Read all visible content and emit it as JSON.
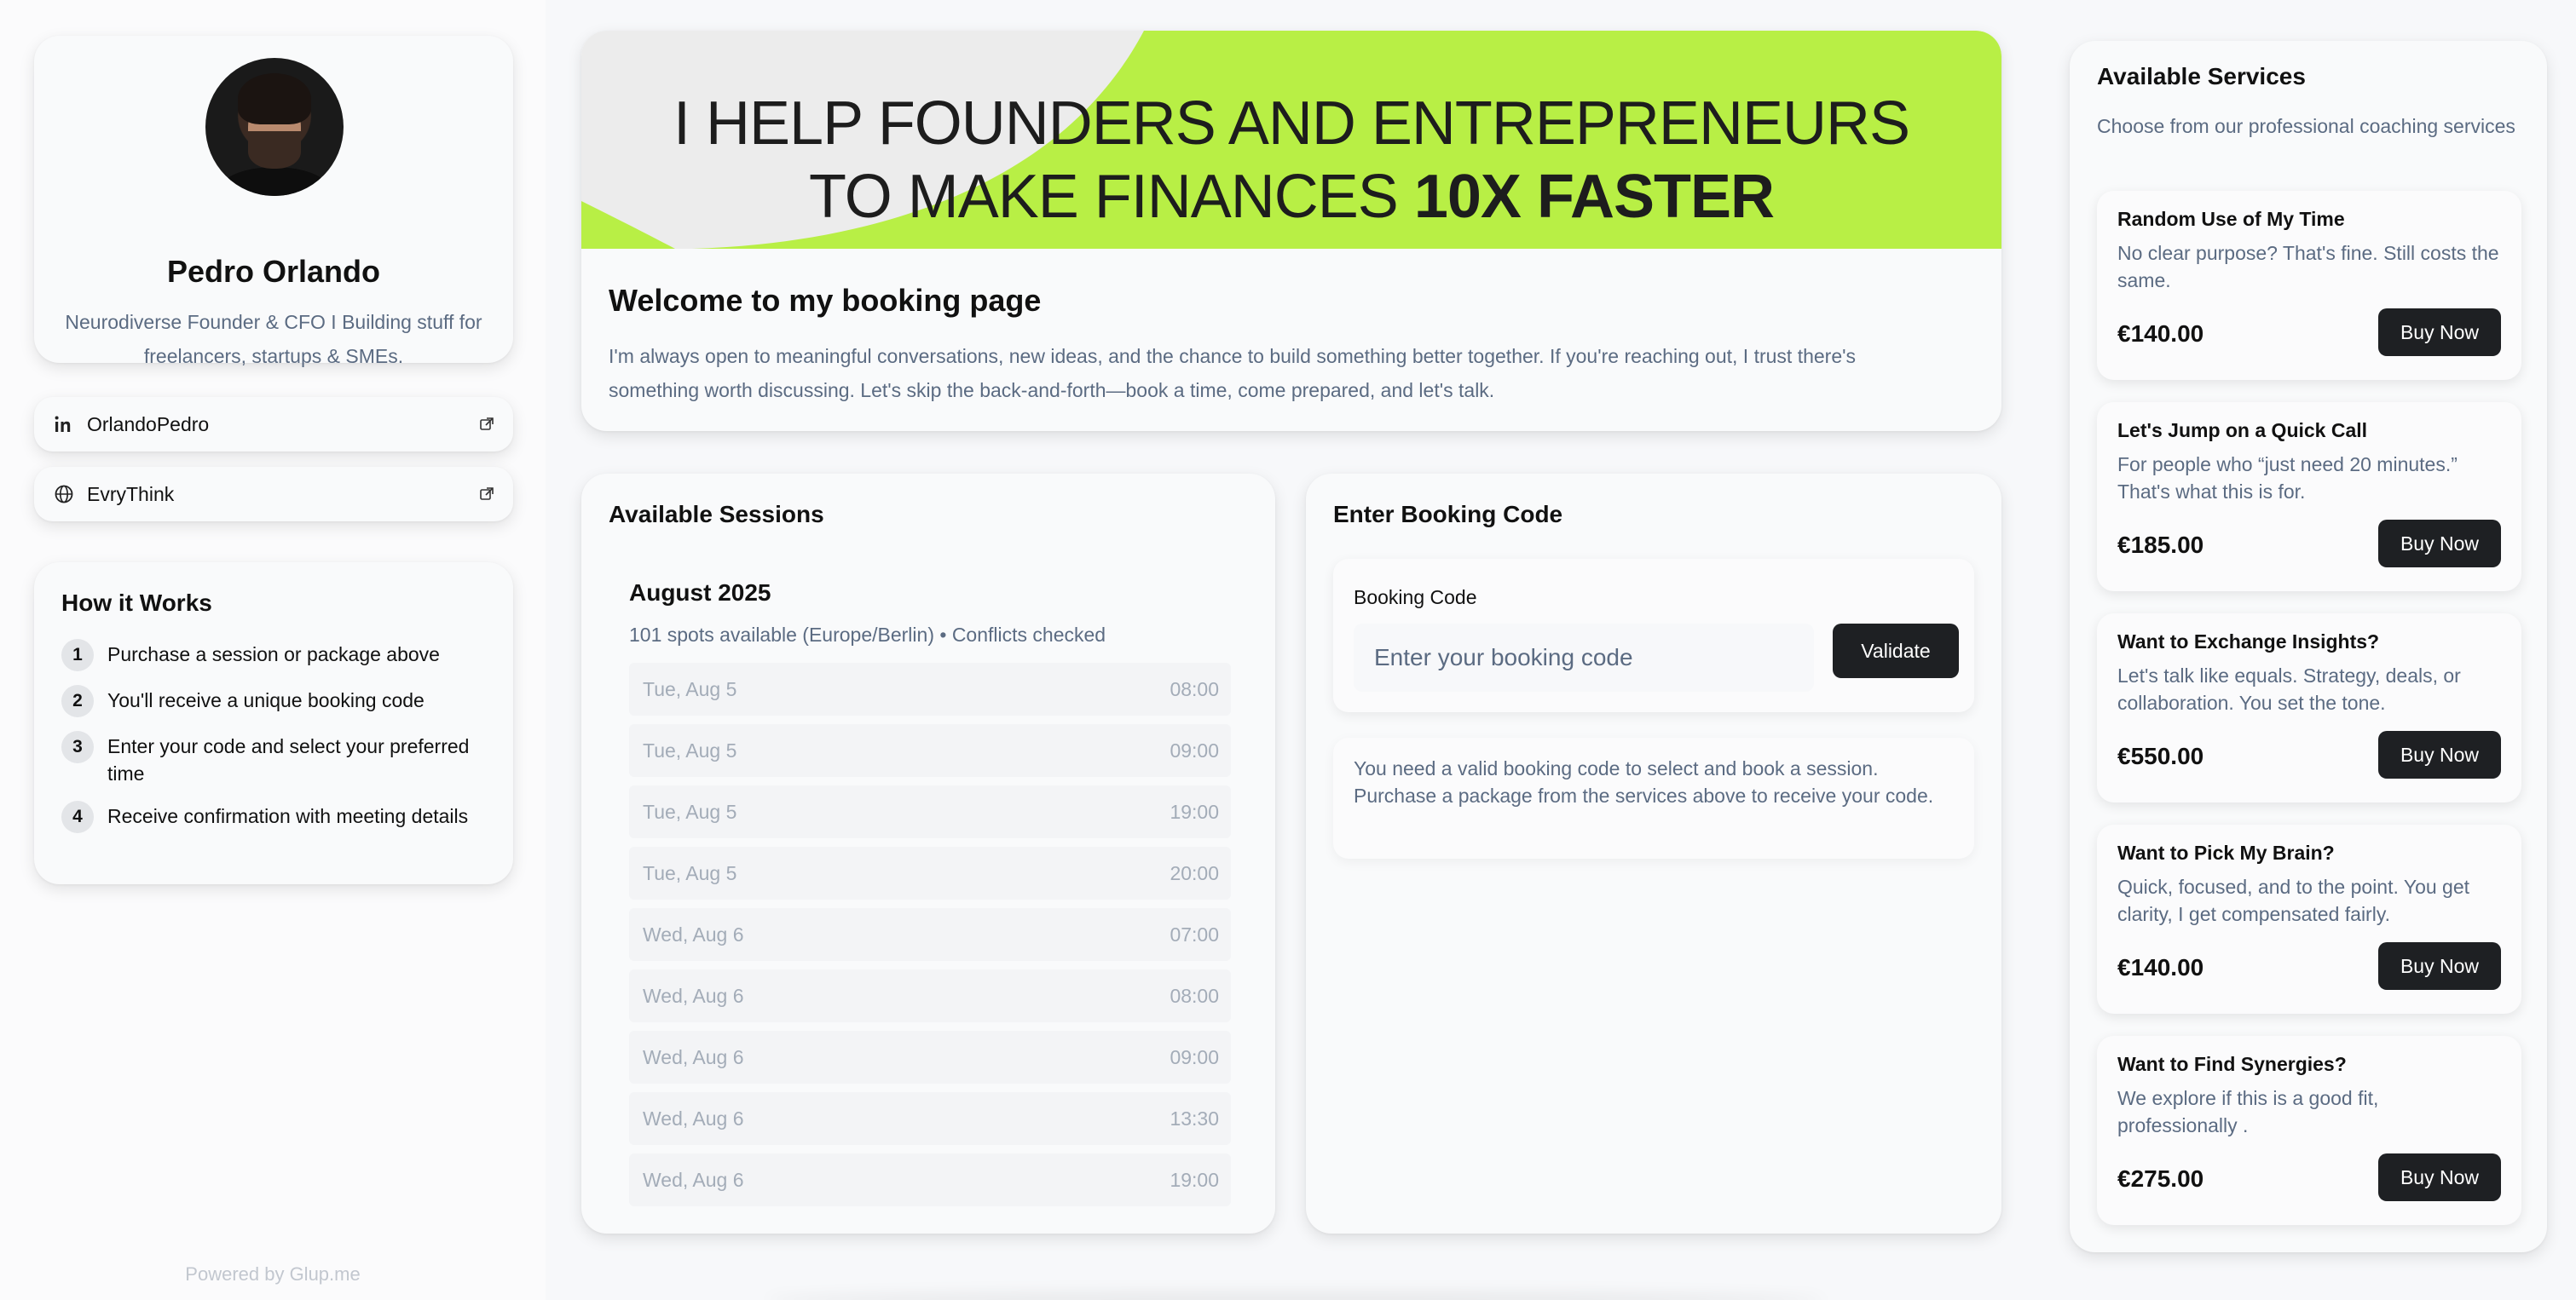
{
  "profile": {
    "name": "Pedro Orlando",
    "bio": "Neurodiverse Founder & CFO I Building stuff for freelancers, startups & SMEs."
  },
  "links": [
    {
      "label": "OrlandoPedro",
      "icon": "linkedin-icon"
    },
    {
      "label": "EvryThink",
      "icon": "globe-icon"
    }
  ],
  "how_it_works": {
    "title": "How it Works",
    "steps": [
      {
        "num": "1",
        "text": "Purchase a session or package above"
      },
      {
        "num": "2",
        "text": "You'll receive a unique booking code"
      },
      {
        "num": "3",
        "text": "Enter your code and select your preferred time"
      },
      {
        "num": "4",
        "text": "Receive confirmation with meeting details"
      }
    ]
  },
  "footer": {
    "powered": "Powered by Glup.me"
  },
  "hero": {
    "banner_line1": "I HELP FOUNDERS AND ENTREPRENEURS",
    "banner_line2_plain": "TO MAKE FINANCES ",
    "banner_line2_bold": "10X FASTER",
    "title": "Welcome to my booking page",
    "text": "I'm always open to meaningful conversations, new ideas, and the chance to build something better together. If you're reaching out, I trust there's something worth discussing. Let's skip the back-and-forth—book a time, come prepared, and let's talk.",
    "accent_color": "#b8ef45"
  },
  "sessions": {
    "title": "Available Sessions",
    "month": "August 2025",
    "availability": "101 spots available (Europe/Berlin) • Conflicts checked",
    "slots": [
      {
        "day": "Tue, Aug 5",
        "time": "08:00"
      },
      {
        "day": "Tue, Aug 5",
        "time": "09:00"
      },
      {
        "day": "Tue, Aug 5",
        "time": "19:00"
      },
      {
        "day": "Tue, Aug 5",
        "time": "20:00"
      },
      {
        "day": "Wed, Aug 6",
        "time": "07:00"
      },
      {
        "day": "Wed, Aug 6",
        "time": "08:00"
      },
      {
        "day": "Wed, Aug 6",
        "time": "09:00"
      },
      {
        "day": "Wed, Aug 6",
        "time": "13:30"
      },
      {
        "day": "Wed, Aug 6",
        "time": "19:00"
      }
    ]
  },
  "booking": {
    "title": "Enter Booking Code",
    "label": "Booking Code",
    "placeholder": "Enter your booking code",
    "value": "",
    "validate_label": "Validate",
    "note": "You need a valid booking code to select and book a session. Purchase a package from the services above to receive your code."
  },
  "services": {
    "title": "Available Services",
    "subtitle": "Choose from our professional coaching services",
    "items": [
      {
        "title": "Random Use of My Time",
        "desc": "No clear purpose? That's fine. Still costs the same.",
        "price": "€140.00",
        "buy": "Buy Now"
      },
      {
        "title": "Let's Jump on a Quick Call",
        "desc": "For people who “just need 20 minutes.” That's what this is for.",
        "price": "€185.00",
        "buy": "Buy Now"
      },
      {
        "title": "Want to Exchange Insights?",
        "desc": "Let's talk like equals. Strategy, deals, or collaboration. You set the tone.",
        "price": "€550.00",
        "buy": "Buy Now"
      },
      {
        "title": "Want to Pick My Brain?",
        "desc": "Quick, focused, and to the point. You get clarity, I get compensated fairly.",
        "price": "€140.00",
        "buy": "Buy Now"
      },
      {
        "title": "Want to Find Synergies?",
        "desc": "We explore if this is a good fit, professionally .",
        "price": "€275.00",
        "buy": "Buy Now"
      }
    ]
  }
}
